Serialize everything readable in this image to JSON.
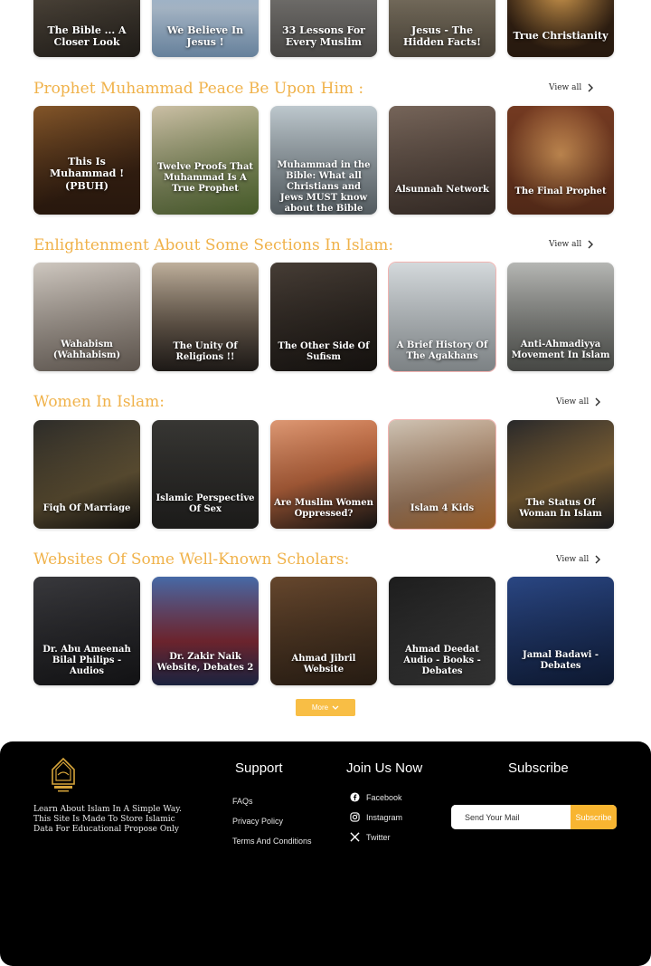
{
  "top_row": [
    {
      "title": "The Bible ... A Closer Look",
      "gradient": "linear-gradient(160deg,#6f6353,#2f2a24)"
    },
    {
      "title": "We Believe In Jesus !",
      "gradient": "linear-gradient(180deg,#7fb2e6,#cfe3f7 55%,#9ec6ee)"
    },
    {
      "title": "33 Lessons For Every Muslim",
      "gradient": "linear-gradient(180deg,#9a9894,#6f6c69)"
    },
    {
      "title": "Jesus - The Hidden Facts!",
      "gradient": "linear-gradient(180deg,#a59a84,#6e6454)"
    },
    {
      "title": "True Christianity",
      "gradient": "radial-gradient(circle at 50% 40%,#f3b25a,#3b2616 70%)"
    }
  ],
  "sections": [
    {
      "title": "Prophet Muhammad Peace Be Upon Him :",
      "view_all": "View all",
      "cards": [
        {
          "title": "This Is Muhammad ! (PBUH)",
          "gradient": "linear-gradient(160deg,#8a5a2b,#3d2414 70%)"
        },
        {
          "title": "Twelve Proofs That Muhammad Is A True Prophet",
          "gradient": "linear-gradient(160deg,#d6c9ae,#8f9b67 60%,#6b8a3f)"
        },
        {
          "title": "Muhammad in the Bible: What all Christians and Jews MUST know about the Bible",
          "gradient": "linear-gradient(180deg,#c7d2d8,#7f8b92)"
        },
        {
          "title": "Alsunnah Network",
          "gradient": "linear-gradient(160deg,#7c6a5e,#4d3e36)"
        },
        {
          "title": "The Final Prophet",
          "gradient": "radial-gradient(circle at 50% 45%,#e2a05e,#7a3d23 70%)"
        }
      ]
    },
    {
      "title": "Enlightenment About Some Sections In Islam:",
      "view_all": "View all",
      "cards": [
        {
          "title": "Wahabism (Wahhabism)",
          "gradient": "linear-gradient(160deg,#d9d2ca,#8c7f74)"
        },
        {
          "title": "The Unity Of Religions !!",
          "gradient": "linear-gradient(180deg,#c9b9a4,#6d5f51 60%,#2c2622)"
        },
        {
          "title": "The Other Side Of Sufism",
          "gradient": "linear-gradient(160deg,#4a4038,#1f1a16)"
        },
        {
          "title": "A Brief History Of The Agakhans",
          "gradient": "linear-gradient(180deg,#dfe4e7,#bfc7cb)"
        },
        {
          "title": "Anti-Ahmadiyya Movement In Islam",
          "gradient": "linear-gradient(180deg,#bfc0bd,#6b6d68)"
        }
      ]
    },
    {
      "title": "Women In Islam:",
      "view_all": "View all",
      "cards": [
        {
          "title": "Fiqh Of Marriage",
          "gradient": "linear-gradient(160deg,#2f2e2b,#6a5a3a 60%,#1e1b17)"
        },
        {
          "title": "Islamic Perspective Of Sex",
          "gradient": "linear-gradient(180deg,#3a3936,#2a2927)"
        },
        {
          "title": "Are Muslim Women Oppressed?",
          "gradient": "linear-gradient(160deg,#e8a07a,#c96e43 50%,#1f1d1b)"
        },
        {
          "title": "Islam 4 Kids",
          "gradient": "linear-gradient(160deg,#d9cdbd,#b88f6f 60%,#e58a3a)"
        },
        {
          "title": "The Status Of Woman In Islam",
          "gradient": "linear-gradient(160deg,#2a2a2c,#8a6a3a 55%,#2a2a2c)"
        }
      ]
    },
    {
      "title": "Websites Of Some Well-Known Scholars:",
      "view_all": "View all",
      "cards": [
        {
          "title": "Dr. Abu Ameenah Bilal Philips - Audios",
          "gradient": "linear-gradient(160deg,#3b3b3f,#1c1c1f)"
        },
        {
          "title": "Dr. Zakir Naik Website, Debates 2",
          "gradient": "linear-gradient(180deg,#4a6fb0,#8b2e3a 60%,#2a3560)"
        },
        {
          "title": "Ahmad Jibril Website",
          "gradient": "linear-gradient(160deg,#6b4a2f,#3a2a1c)"
        },
        {
          "title": "Ahmad Deedat Audio - Books - Debates",
          "gradient": "linear-gradient(160deg,#1e1e1e,#4a4a4a)"
        },
        {
          "title": "Jamal Badawi - Debates",
          "gradient": "linear-gradient(160deg,#2c4a8a,#14254a)"
        }
      ]
    }
  ],
  "more_button": {
    "label": "More"
  },
  "footer": {
    "about": "Learn About Islam In A Simple Way. This Site Is Made To Store Islamic Data For Educational Propose Only",
    "support": {
      "heading": "Support",
      "links": [
        "FAQs",
        "Privacy Policy",
        "Terms And Conditions"
      ]
    },
    "join": {
      "heading": "Join Us Now",
      "links": [
        {
          "label": "Facebook",
          "icon": "facebook-icon"
        },
        {
          "label": "Instagram",
          "icon": "instagram-icon"
        },
        {
          "label": "Twitter",
          "icon": "x-icon"
        }
      ]
    },
    "subscribe": {
      "heading": "Subscribe",
      "placeholder": "Send Your Mail",
      "button": "Subscribe"
    }
  },
  "colors": {
    "accent": "#f0b24a",
    "button": "#f8b531",
    "footer_bg": "#000000"
  }
}
